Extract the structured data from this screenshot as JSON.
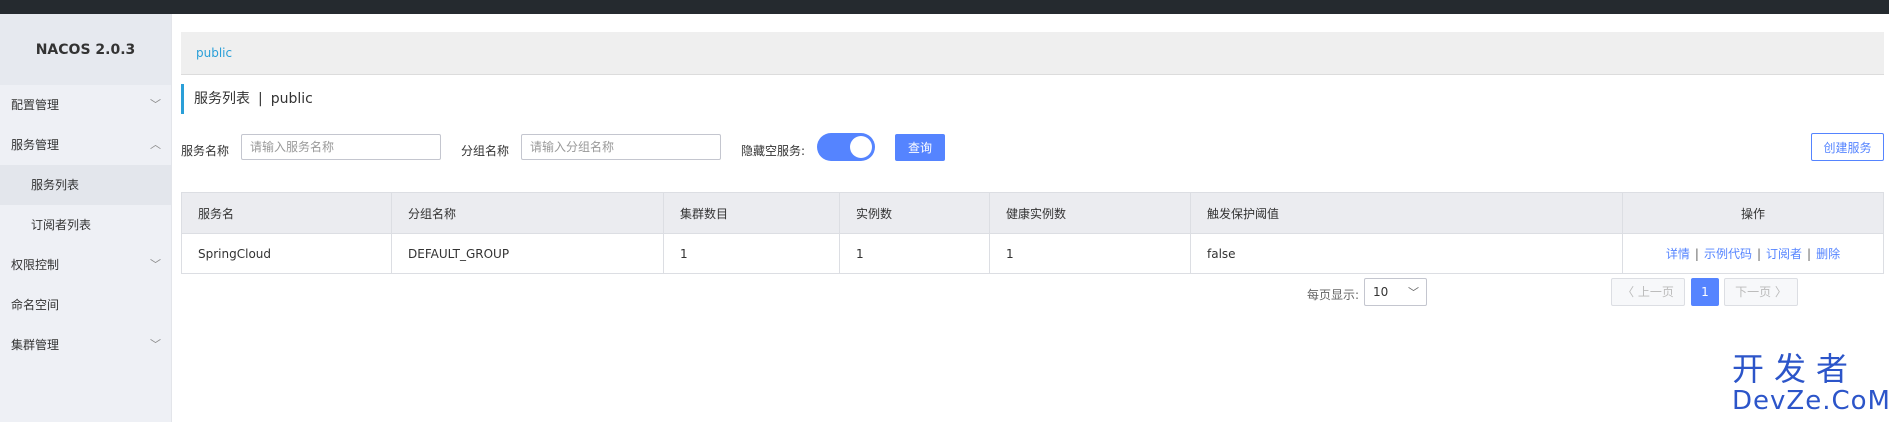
{
  "sidebar": {
    "brand": "NACOS 2.0.3",
    "items": [
      {
        "label": "配置管理",
        "chevron": "﹀"
      },
      {
        "label": "服务管理",
        "chevron": "︿"
      },
      {
        "label": "服务列表"
      },
      {
        "label": "订阅者列表"
      },
      {
        "label": "权限控制",
        "chevron": "﹀"
      },
      {
        "label": "命名空间"
      },
      {
        "label": "集群管理",
        "chevron": "﹀"
      }
    ]
  },
  "breadcrumb": {
    "namespace": "public"
  },
  "page": {
    "title": "服务列表",
    "separator": "|",
    "namespace": "public"
  },
  "filters": {
    "service_name_label": "服务名称",
    "service_name_placeholder": "请输入服务名称",
    "group_name_label": "分组名称",
    "group_name_placeholder": "请输入分组名称",
    "hide_empty_label": "隐藏空服务:",
    "hide_empty_on": true,
    "query_label": "查询",
    "create_label": "创建服务"
  },
  "table": {
    "headers": [
      "服务名",
      "分组名称",
      "集群数目",
      "实例数",
      "健康实例数",
      "触发保护阈值",
      "操作"
    ],
    "rows": [
      {
        "cells": [
          "SpringCloud",
          "DEFAULT_GROUP",
          "1",
          "1",
          "1",
          "false"
        ],
        "ops": [
          "详情",
          "示例代码",
          "订阅者",
          "删除"
        ],
        "op_sep": "|"
      }
    ]
  },
  "pager": {
    "per_page_label": "每页显示:",
    "page_size": "10",
    "prev_label": "〈 上一页",
    "current_page": "1",
    "next_label": "下一页 〉",
    "chevron": "﹀"
  },
  "watermark": {
    "line1": "开发者",
    "line2": "DevZe.CoM"
  },
  "colors": {
    "primary": "#5584ff",
    "link": "#2a9fd8",
    "sidebar_bg": "#eef0f5",
    "topbar": "#252a2f"
  }
}
